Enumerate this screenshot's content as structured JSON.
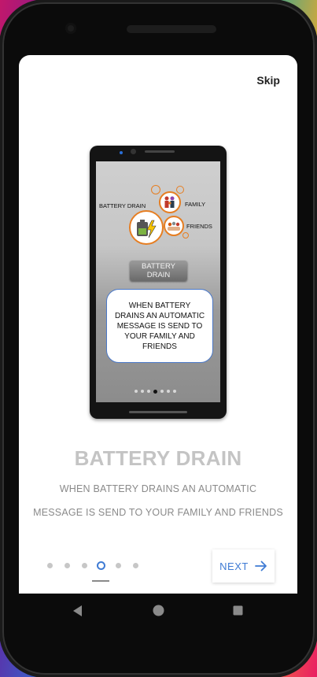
{
  "skip_label": "Skip",
  "illustration": {
    "battery_drain_label": "BATTERY DRAIN",
    "family_label": "FAMILY",
    "friends_label": "FRIENDS",
    "button_label_line1": "BATTERY",
    "button_label_line2": "DRAIN",
    "message_text": "WHEN BATTERY DRAINS AN AUTOMATIC MESSAGE IS SEND TO YOUR FAMILY AND FRIENDS",
    "pager_dot_count": 7,
    "pager_active_index": 3
  },
  "title": "BATTERY DRAIN",
  "description_line1": "WHEN BATTERY DRAINS AN AUTOMATIC",
  "description_line2": "MESSAGE IS SEND TO YOUR FAMILY AND FRIENDS",
  "pager": {
    "count": 6,
    "active_index": 3
  },
  "next_label": "NEXT",
  "colors": {
    "accent": "#3f7bd4",
    "title": "#c4c4c4",
    "orange": "#e67e22"
  },
  "navbar": {
    "icons": [
      "back-icon",
      "home-icon",
      "recents-icon"
    ]
  }
}
